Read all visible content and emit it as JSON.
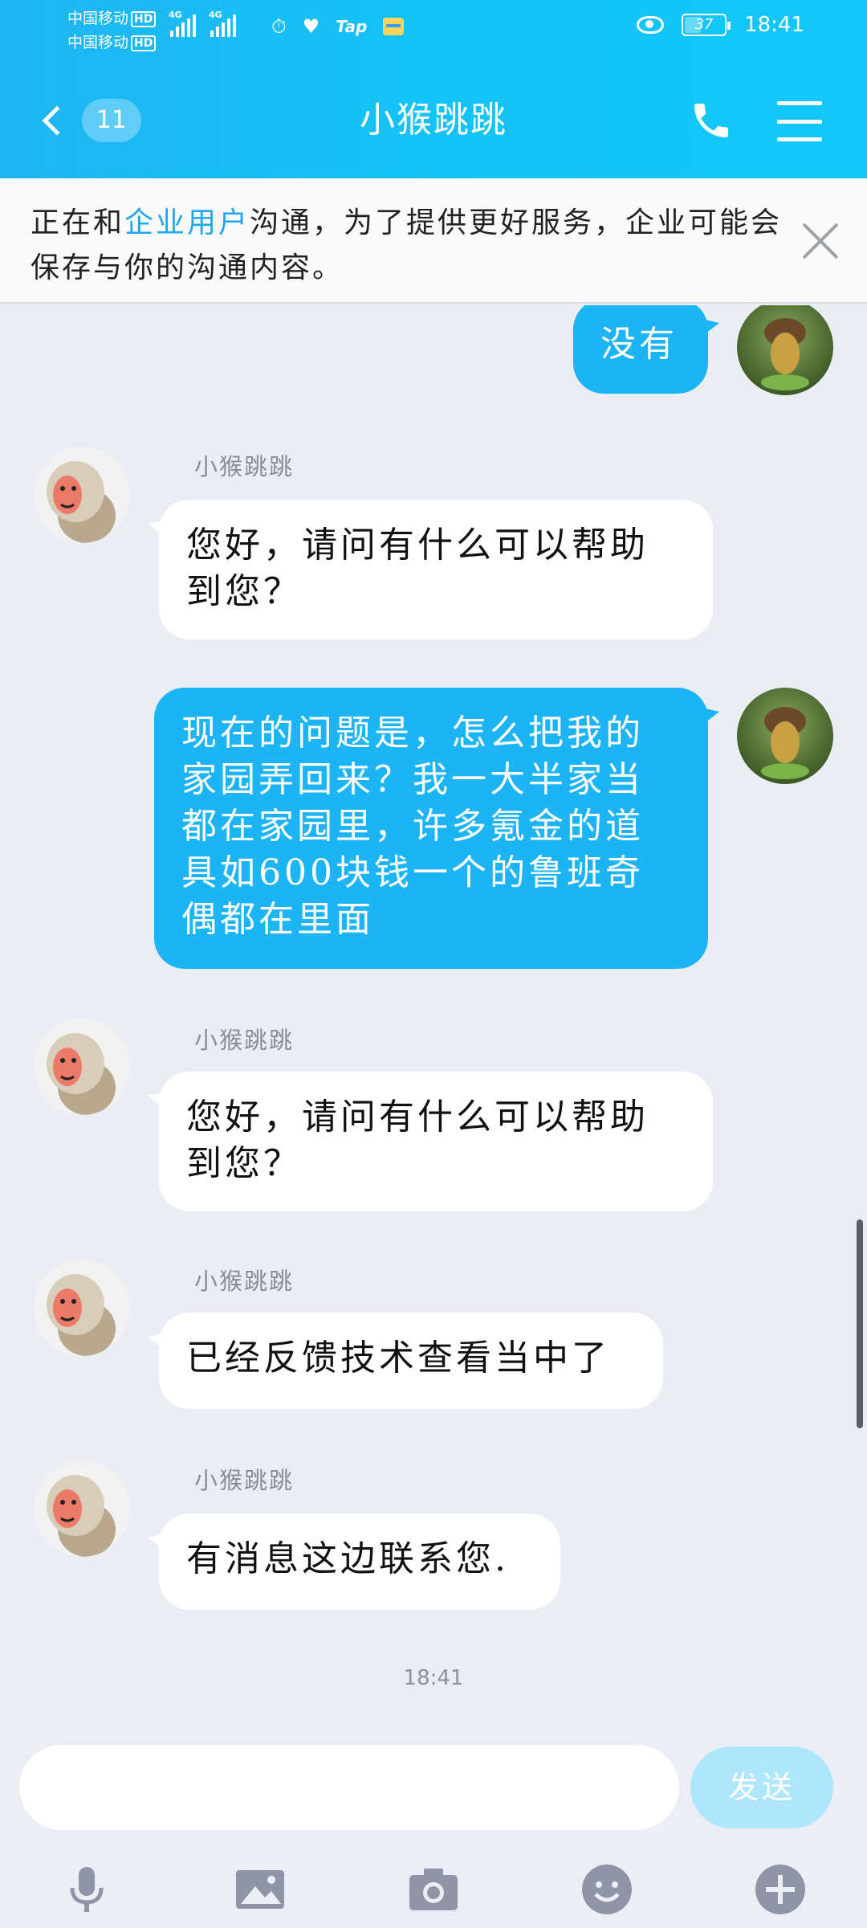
{
  "status_bar": {
    "carrier_1": "中国移动",
    "carrier_2": "中国移动",
    "hd": "HD",
    "network": "4G",
    "tap_label": "Tap",
    "battery": "37",
    "time": "18:41"
  },
  "nav": {
    "unread_count": "11",
    "title": "小猴跳跳"
  },
  "notice": {
    "prefix": "正在和",
    "highlight": "企业用户",
    "suffix": "沟通，为了提供更好服务，企业可能会保存与你的沟通内容。",
    "highlight_color": "#1fa7ee"
  },
  "messages": [
    {
      "side": "out",
      "text": "没有"
    },
    {
      "side": "in",
      "sender": "小猴跳跳",
      "text": "您好，请问有什么可以帮助到您？"
    },
    {
      "side": "out",
      "text": "现在的问题是，怎么把我的家园弄回来？我一大半家当都在家园里，许多氪金的道具如600块钱一个的鲁班奇偶都在里面"
    },
    {
      "side": "in",
      "sender": "小猴跳跳",
      "text": "您好，请问有什么可以帮助到您？"
    },
    {
      "side": "in",
      "sender": "小猴跳跳",
      "text": "已经反馈技术查看当中了"
    },
    {
      "side": "in",
      "sender": "小猴跳跳",
      "text": "有消息这边联系您."
    }
  ],
  "timestamp": "18:41",
  "input": {
    "value": "",
    "placeholder": "",
    "send_label": "发送"
  },
  "toolbar": {
    "icons": [
      "microphone-icon",
      "image-icon",
      "camera-icon",
      "emoji-icon",
      "plus-icon"
    ]
  },
  "colors": {
    "header": "#1fb4f3",
    "outgoing_bubble": "#1db4f5",
    "incoming_bubble": "#ffffff",
    "send_button": "#aee6fb",
    "background": "#ebedf5"
  }
}
